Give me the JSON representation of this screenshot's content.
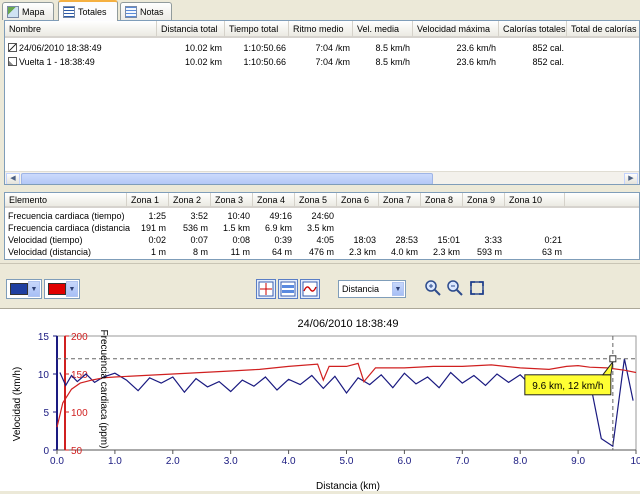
{
  "tabs": [
    {
      "label": "Mapa",
      "icon": "map-icon",
      "active": false
    },
    {
      "label": "Totales",
      "icon": "table-icon",
      "active": true
    },
    {
      "label": "Notas",
      "icon": "notes-icon",
      "active": false
    }
  ],
  "totals_table": {
    "headers": [
      "Nombre",
      "Distancia total",
      "Tiempo total",
      "Ritmo medio",
      "Vel. media",
      "Velocidad máxima",
      "Calorías totales",
      "Total de calorías"
    ],
    "rows": [
      {
        "icon": "runner-icon",
        "cells": [
          "24/06/2010 18:38:49",
          "10.02 km",
          "1:10:50.66",
          "7:04 /km",
          "8.5 km/h",
          "23.6 km/h",
          "852 cal."
        ]
      },
      {
        "icon": "lap-icon",
        "cells": [
          "Vuelta 1 - 18:38:49",
          "10.02 km",
          "1:10:50.66",
          "7:04 /km",
          "8.5 km/h",
          "23.6 km/h",
          "852 cal."
        ]
      }
    ]
  },
  "zones_table": {
    "headers": [
      "Elemento",
      "Zona 1",
      "Zona 2",
      "Zona 3",
      "Zona 4",
      "Zona 5",
      "Zona 6",
      "Zona 7",
      "Zona 8",
      "Zona 9",
      "Zona 10"
    ],
    "rows": [
      [
        "Frecuencia cardiaca (tiempo)",
        "1:25",
        "3:52",
        "10:40",
        "49:16",
        "24:60",
        "",
        "",
        "",
        "",
        ""
      ],
      [
        "Frecuencia cardiaca (distancia)",
        "191 m",
        "536 m",
        "1.5 km",
        "6.9 km",
        "3.5 km",
        "",
        "",
        "",
        "",
        ""
      ],
      [
        "Velocidad (tiempo)",
        "0:02",
        "0:07",
        "0:08",
        "0:39",
        "4:05",
        "18:03",
        "28:53",
        "15:01",
        "3:33",
        "0:21"
      ],
      [
        "Velocidad (distancia)",
        "1 m",
        "8 m",
        "11 m",
        "64 m",
        "476 m",
        "2.3 km",
        "4.0 km",
        "2.3 km",
        "593 m",
        "63 m"
      ]
    ]
  },
  "toolbar": {
    "color1": "#1f3fa0",
    "color2": "#e00000",
    "xaxis_select": "Distancia",
    "view_buttons": [
      "crosshair-icon",
      "split-view-icon",
      "smooth-line-icon"
    ],
    "zoom_buttons": [
      "zoom-in-icon",
      "zoom-out-icon",
      "fit-icon"
    ]
  },
  "chart_data": {
    "type": "line",
    "title": "24/06/2010 18:38:49",
    "xlabel": "Distancia (km)",
    "xlim": [
      0,
      10
    ],
    "xticks": [
      "0.0",
      "1.0",
      "2.0",
      "3.0",
      "4.0",
      "5.0",
      "6.0",
      "7.0",
      "8.0",
      "9.0",
      "10"
    ],
    "y_left": {
      "label": "Velocidad (km/h)",
      "lim": [
        0,
        15
      ],
      "ticks": [
        "0",
        "5",
        "10",
        "15"
      ],
      "color": "#1a1a80"
    },
    "y_right": {
      "label": "Frecuencia cardiaca (ppm)",
      "lim": [
        50,
        200
      ],
      "ticks": [
        "50",
        "100",
        "150",
        "200"
      ],
      "color": "#d02020"
    },
    "series": [
      {
        "name": "Velocidad",
        "axis": "left",
        "color": "#1a1a80",
        "x": [
          0.05,
          0.15,
          0.25,
          0.35,
          0.5,
          0.65,
          0.8,
          1.0,
          1.2,
          1.4,
          1.6,
          1.8,
          2.0,
          2.2,
          2.4,
          2.6,
          2.8,
          3.0,
          3.2,
          3.4,
          3.6,
          3.8,
          4.0,
          4.2,
          4.4,
          4.6,
          4.8,
          5.0,
          5.2,
          5.4,
          5.6,
          5.8,
          6.0,
          6.2,
          6.4,
          6.6,
          6.8,
          7.0,
          7.2,
          7.4,
          7.6,
          7.8,
          8.0,
          8.2,
          8.4,
          8.6,
          8.8,
          9.0,
          9.2,
          9.4,
          9.6,
          9.8,
          9.95
        ],
        "y": [
          10.2,
          8.5,
          9.8,
          9.0,
          10.0,
          8.9,
          9.6,
          10.1,
          9.2,
          7.8,
          9.5,
          8.8,
          9.6,
          7.6,
          9.4,
          8.3,
          9.0,
          7.7,
          9.2,
          8.4,
          9.6,
          7.9,
          9.3,
          8.6,
          9.8,
          8.1,
          9.7,
          7.5,
          9.5,
          8.6,
          9.9,
          8.2,
          10.1,
          8.7,
          9.6,
          8.2,
          10.2,
          8.8,
          9.8,
          8.5,
          10.0,
          8.9,
          9.9,
          8.4,
          9.7,
          8.8,
          9.5,
          8.6,
          9.2,
          1.5,
          0.5,
          12.0,
          6.5
        ]
      },
      {
        "name": "Frecuencia cardiaca",
        "axis": "right",
        "color": "#d02020",
        "x": [
          0.0,
          0.1,
          0.25,
          0.4,
          0.6,
          0.8,
          1.0,
          1.5,
          2.0,
          2.5,
          3.0,
          3.5,
          4.0,
          4.5,
          4.6,
          4.7,
          5.0,
          5.2,
          5.3,
          5.5,
          6.0,
          6.5,
          7.0,
          7.5,
          8.0,
          8.5,
          8.8,
          9.0,
          9.2,
          9.5,
          9.8,
          10.0
        ],
        "y": [
          80,
          112,
          130,
          138,
          142,
          145,
          146,
          148,
          150,
          152,
          154,
          156,
          160,
          163,
          142,
          160,
          160,
          164,
          140,
          158,
          158,
          160,
          160,
          162,
          158,
          156,
          160,
          161,
          159,
          158,
          155,
          152
        ]
      }
    ],
    "marker": {
      "x": 9.6,
      "y": 12,
      "label": "9.6 km, 12 km/h"
    },
    "grid": false
  }
}
